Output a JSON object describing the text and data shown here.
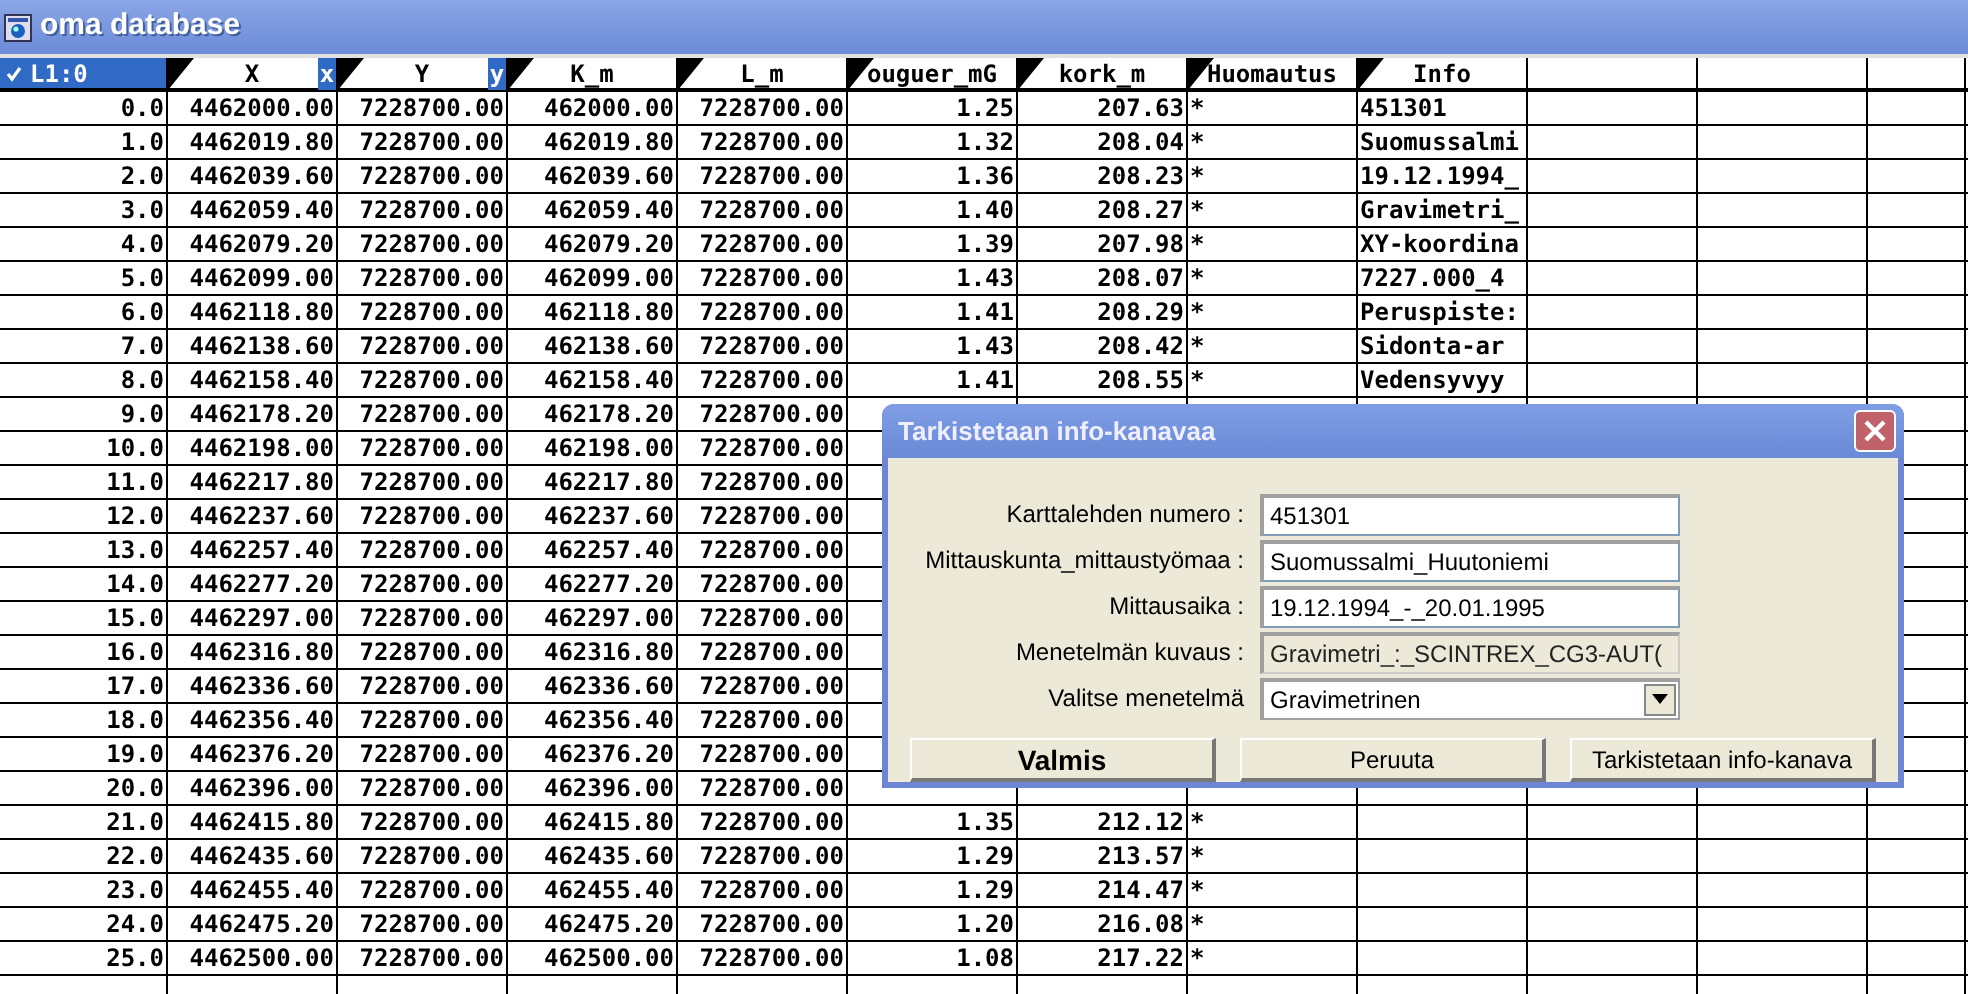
{
  "window": {
    "title": "oma database"
  },
  "table": {
    "corner": "L1:0",
    "columns": [
      {
        "label": "X",
        "tag": "x"
      },
      {
        "label": "Y",
        "tag": "y"
      },
      {
        "label": "K_m"
      },
      {
        "label": "L_m"
      },
      {
        "label": "ouguer_mG"
      },
      {
        "label": "kork_m"
      },
      {
        "label": "Huomautus"
      },
      {
        "label": "Info"
      }
    ],
    "rows": [
      {
        "index": "0.0",
        "cells": [
          "4462000.00",
          "7228700.00",
          "462000.00",
          "7228700.00",
          "1.25",
          "207.63",
          "*",
          "451301"
        ]
      },
      {
        "index": "1.0",
        "cells": [
          "4462019.80",
          "7228700.00",
          "462019.80",
          "7228700.00",
          "1.32",
          "208.04",
          "*",
          "Suomussalmi"
        ]
      },
      {
        "index": "2.0",
        "cells": [
          "4462039.60",
          "7228700.00",
          "462039.60",
          "7228700.00",
          "1.36",
          "208.23",
          "*",
          "19.12.1994_"
        ]
      },
      {
        "index": "3.0",
        "cells": [
          "4462059.40",
          "7228700.00",
          "462059.40",
          "7228700.00",
          "1.40",
          "208.27",
          "*",
          "Gravimetri_"
        ]
      },
      {
        "index": "4.0",
        "cells": [
          "4462079.20",
          "7228700.00",
          "462079.20",
          "7228700.00",
          "1.39",
          "207.98",
          "*",
          "XY-koordina"
        ]
      },
      {
        "index": "5.0",
        "cells": [
          "4462099.00",
          "7228700.00",
          "462099.00",
          "7228700.00",
          "1.43",
          "208.07",
          "*",
          "7227.000_4"
        ]
      },
      {
        "index": "6.0",
        "cells": [
          "4462118.80",
          "7228700.00",
          "462118.80",
          "7228700.00",
          "1.41",
          "208.29",
          "*",
          "Peruspiste:"
        ]
      },
      {
        "index": "7.0",
        "cells": [
          "4462138.60",
          "7228700.00",
          "462138.60",
          "7228700.00",
          "1.43",
          "208.42",
          "*",
          "Sidonta-ar"
        ]
      },
      {
        "index": "8.0",
        "cells": [
          "4462158.40",
          "7228700.00",
          "462158.40",
          "7228700.00",
          "1.41",
          "208.55",
          "*",
          "Vedensyvyy"
        ]
      },
      {
        "index": "9.0",
        "cells": [
          "4462178.20",
          "7228700.00",
          "462178.20",
          "7228700.00"
        ]
      },
      {
        "index": "10.0",
        "cells": [
          "4462198.00",
          "7228700.00",
          "462198.00",
          "7228700.00"
        ]
      },
      {
        "index": "11.0",
        "cells": [
          "4462217.80",
          "7228700.00",
          "462217.80",
          "7228700.00"
        ]
      },
      {
        "index": "12.0",
        "cells": [
          "4462237.60",
          "7228700.00",
          "462237.60",
          "7228700.00"
        ]
      },
      {
        "index": "13.0",
        "cells": [
          "4462257.40",
          "7228700.00",
          "462257.40",
          "7228700.00"
        ]
      },
      {
        "index": "14.0",
        "cells": [
          "4462277.20",
          "7228700.00",
          "462277.20",
          "7228700.00"
        ]
      },
      {
        "index": "15.0",
        "cells": [
          "4462297.00",
          "7228700.00",
          "462297.00",
          "7228700.00"
        ]
      },
      {
        "index": "16.0",
        "cells": [
          "4462316.80",
          "7228700.00",
          "462316.80",
          "7228700.00"
        ]
      },
      {
        "index": "17.0",
        "cells": [
          "4462336.60",
          "7228700.00",
          "462336.60",
          "7228700.00"
        ]
      },
      {
        "index": "18.0",
        "cells": [
          "4462356.40",
          "7228700.00",
          "462356.40",
          "7228700.00"
        ]
      },
      {
        "index": "19.0",
        "cells": [
          "4462376.20",
          "7228700.00",
          "462376.20",
          "7228700.00"
        ]
      },
      {
        "index": "20.0",
        "cells": [
          "4462396.00",
          "7228700.00",
          "462396.00",
          "7228700.00"
        ]
      },
      {
        "index": "21.0",
        "cells": [
          "4462415.80",
          "7228700.00",
          "462415.80",
          "7228700.00",
          "1.35",
          "212.12",
          "*"
        ]
      },
      {
        "index": "22.0",
        "cells": [
          "4462435.60",
          "7228700.00",
          "462435.60",
          "7228700.00",
          "1.29",
          "213.57",
          "*"
        ]
      },
      {
        "index": "23.0",
        "cells": [
          "4462455.40",
          "7228700.00",
          "462455.40",
          "7228700.00",
          "1.29",
          "214.47",
          "*"
        ]
      },
      {
        "index": "24.0",
        "cells": [
          "4462475.20",
          "7228700.00",
          "462475.20",
          "7228700.00",
          "1.20",
          "216.08",
          "*"
        ]
      },
      {
        "index": "25.0",
        "cells": [
          "4462500.00",
          "7228700.00",
          "462500.00",
          "7228700.00",
          "1.08",
          "217.22",
          "*"
        ]
      }
    ]
  },
  "dialog": {
    "title": "Tarkistetaan info-kanavaa",
    "fields": [
      {
        "kind": "text",
        "label": "Karttalehden numero :",
        "value": "451301"
      },
      {
        "kind": "text",
        "label": "Mittauskunta_mittaustyömaa :",
        "value": "Suomussalmi_Huutoniemi"
      },
      {
        "kind": "text",
        "label": "Mittausaika :",
        "value": "19.12.1994_-_20.01.1995"
      },
      {
        "kind": "readonly",
        "label": "Menetelmän kuvaus :",
        "value": "Gravimetri_:_SCINTREX_CG3-AUT("
      },
      {
        "kind": "select",
        "label": "Valitse menetelmä",
        "value": "Gravimetrinen"
      }
    ],
    "buttons": [
      {
        "label": "Valmis",
        "default": true
      },
      {
        "label": "Peruuta",
        "default": false
      },
      {
        "label": "Tarkistetaan info-kanava",
        "default": false
      }
    ]
  }
}
